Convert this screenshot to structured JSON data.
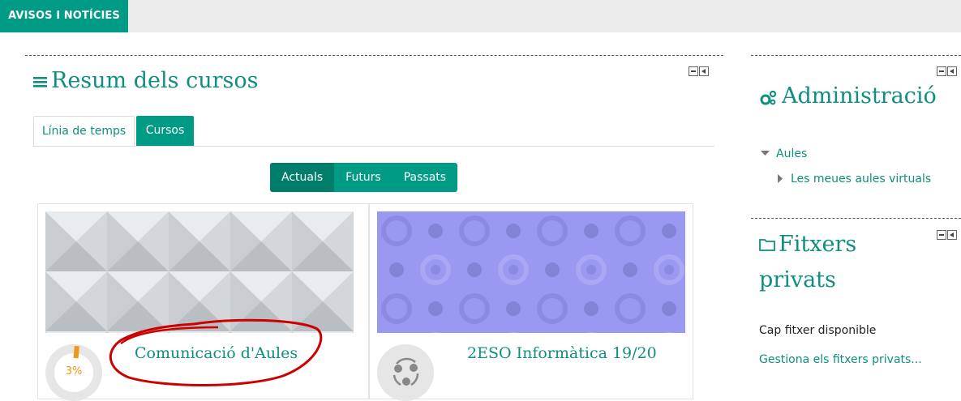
{
  "topnav": {
    "tab_label": "AVISOS I NOTÍCIES"
  },
  "course_overview": {
    "title": "Resum dels cursos",
    "tabs": [
      {
        "label": "Línia de temps",
        "active": false
      },
      {
        "label": "Cursos",
        "active": true
      }
    ],
    "filters": [
      {
        "label": "Actuals",
        "active": true
      },
      {
        "label": "Futurs",
        "active": false
      },
      {
        "label": "Passats",
        "active": false
      }
    ],
    "courses": [
      {
        "name": "Comunicació d'Aules",
        "progress_label": "3%",
        "progress": 0.03,
        "image": "grey-triangles-pattern",
        "annotation": "red-hand-drawn-circle"
      },
      {
        "name": "2ESO Informàtica 19/20",
        "image": "purple-circles-pattern",
        "icon": "course-share-icon"
      }
    ]
  },
  "administration": {
    "title": "Administració",
    "items": [
      {
        "label": "Aules",
        "expanded": true
      },
      {
        "label": "Les meues aules virtuals",
        "expanded": false
      }
    ]
  },
  "private_files": {
    "title_line1": "Fitxers",
    "title_line2": "privats",
    "empty_text": "Cap fitxer disponible",
    "manage_link": "Gestiona els fitxers privats..."
  },
  "colors": {
    "accent": "#009b85",
    "link": "#0f8f7d",
    "progress": "#f0961a",
    "purple": "#9999f2",
    "annotation": "#cc0000"
  }
}
